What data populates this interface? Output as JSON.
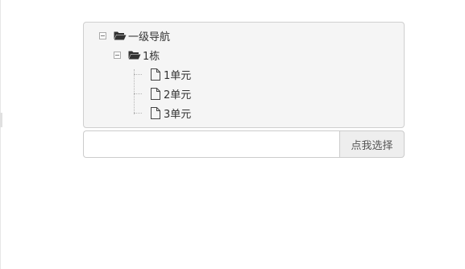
{
  "tree": {
    "root": {
      "label": "一级导航",
      "icon": "folder-open-icon",
      "children": [
        {
          "label": "1栋",
          "icon": "folder-open-icon",
          "children": [
            {
              "label": "1单元",
              "icon": "file-icon"
            },
            {
              "label": "2单元",
              "icon": "file-icon"
            },
            {
              "label": "3单元",
              "icon": "file-icon"
            }
          ]
        }
      ]
    }
  },
  "picker": {
    "input_value": "",
    "input_placeholder": "",
    "button_label": "点我选择"
  },
  "colors": {
    "panel_background": "#f5f5f5",
    "panel_border": "#cfcfcf",
    "button_background": "#eeeeee",
    "text": "#333333"
  }
}
